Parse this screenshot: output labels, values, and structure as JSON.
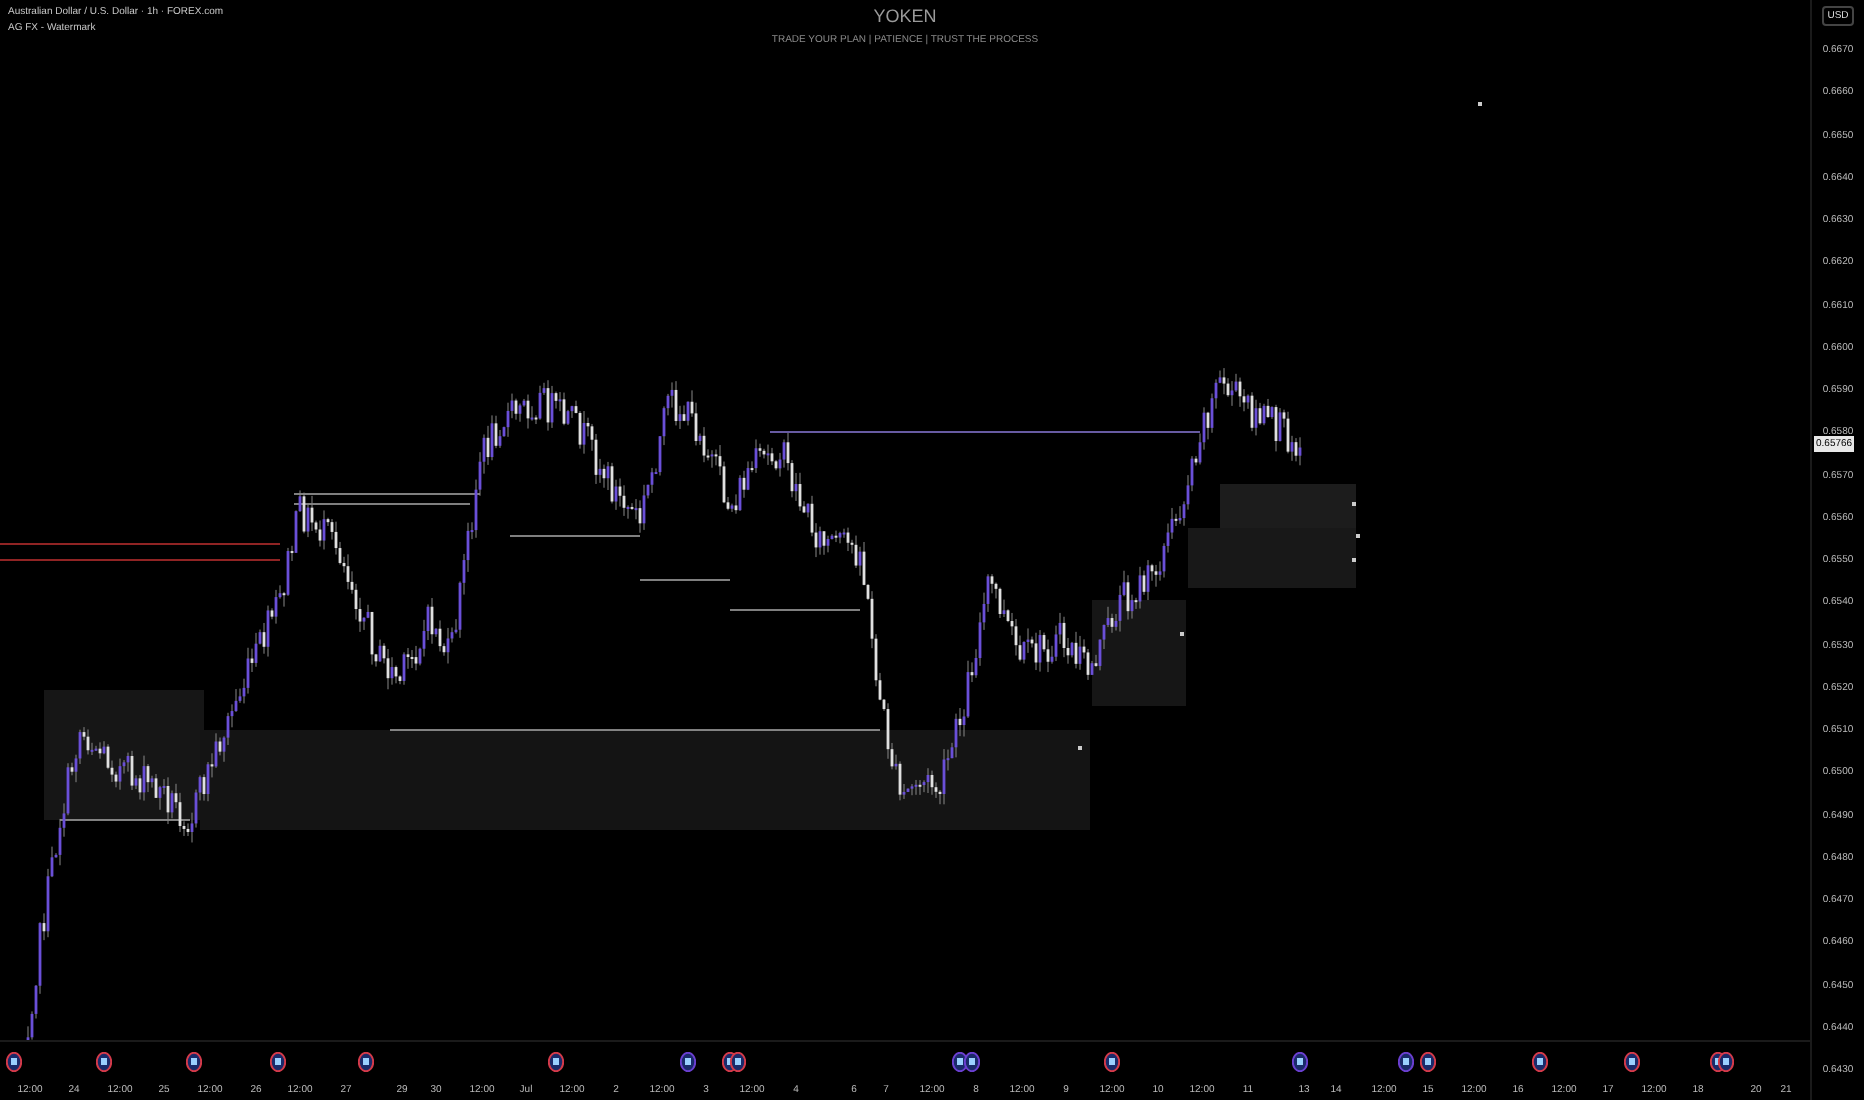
{
  "header": {
    "symbol": "Australian Dollar / U.S. Dollar · 1h · FOREX.com",
    "indicator": "AG FX - Watermark"
  },
  "watermark": {
    "title": "YOKEN",
    "subtitle": "TRADE YOUR PLAN | PATIENCE | TRUST THE PROCESS"
  },
  "price_axis": {
    "currency": "USD",
    "current": "0.65766",
    "ticks": [
      "0.6670",
      "0.6660",
      "0.6650",
      "0.6640",
      "0.6630",
      "0.6620",
      "0.6610",
      "0.6600",
      "0.6590",
      "0.6580",
      "0.6570",
      "0.6560",
      "0.6550",
      "0.6540",
      "0.6530",
      "0.6520",
      "0.6510",
      "0.6500",
      "0.6490",
      "0.6480",
      "0.6470",
      "0.6460",
      "0.6450",
      "0.6440",
      "0.6430"
    ]
  },
  "time_axis": [
    "12:00",
    "24",
    "12:00",
    "25",
    "12:00",
    "26",
    "12:00",
    "27",
    "29",
    "30",
    "12:00",
    "Jul",
    "12:00",
    "2",
    "12:00",
    "3",
    "12:00",
    "4",
    "6",
    "7",
    "12:00",
    "8",
    "12:00",
    "9",
    "12:00",
    "10",
    "12:00",
    "11",
    "13",
    "14",
    "12:00",
    "15",
    "12:00",
    "16",
    "12:00",
    "17",
    "12:00",
    "18",
    "20",
    "21"
  ],
  "events": [
    {
      "color": "#d43a4a"
    },
    {
      "color": "#d43a4a"
    },
    {
      "color": "#d43a4a"
    },
    {
      "color": "#d43a4a"
    },
    {
      "color": "#d43a4a"
    },
    {
      "color": "#d43a4a"
    },
    {
      "color": "#6a3fd0"
    },
    {
      "color": "#d43a4a"
    },
    {
      "color": "#d43a4a"
    },
    {
      "color": "#6a3fd0"
    },
    {
      "color": "#6a3fd0"
    },
    {
      "color": "#d43a4a"
    },
    {
      "color": "#6a3fd0"
    },
    {
      "color": "#6a3fd0"
    },
    {
      "color": "#d43a4a"
    },
    {
      "color": "#d43a4a"
    },
    {
      "color": "#d43a4a"
    },
    {
      "color": "#d43a4a"
    },
    {
      "color": "#d43a4a"
    }
  ]
}
